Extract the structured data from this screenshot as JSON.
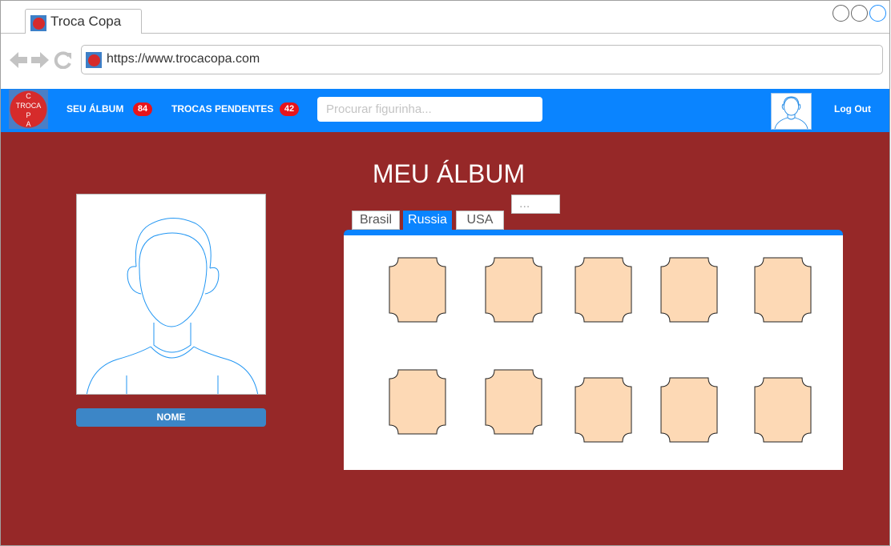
{
  "browser": {
    "tab_title": "Troca Copa",
    "url": "https://www.trocacopa.com"
  },
  "header": {
    "logo_letters": [
      "C",
      "TROCA",
      "P",
      "A"
    ],
    "nav": [
      {
        "label": "SEU ÁLBUM",
        "badge": "84"
      },
      {
        "label": "TROCAS PENDENTES",
        "badge": "42"
      }
    ],
    "search_placeholder": "Procurar figurinha...",
    "logout_label": "Log Out"
  },
  "main": {
    "title": "MEU ÁLBUM",
    "name_button": "NOME",
    "tabs": [
      {
        "label": "Brasil",
        "active": false
      },
      {
        "label": "Russia",
        "active": true
      },
      {
        "label": "USA",
        "active": false
      },
      {
        "label": "...",
        "active": false
      }
    ],
    "sticker_count": 10
  },
  "colors": {
    "header_blue": "#0a84ff",
    "background_red": "#962828",
    "sticker_fill": "#fdd9b5",
    "badge_red": "#e8141b"
  }
}
